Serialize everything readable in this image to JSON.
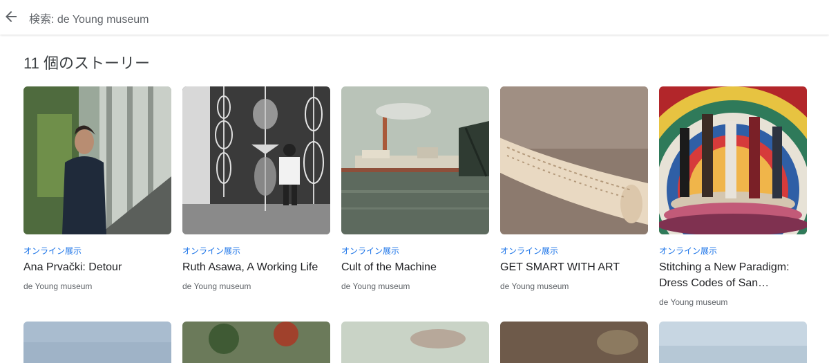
{
  "search": {
    "text": "検索: de Young museum"
  },
  "heading": "11 個のストーリー",
  "cards": [
    {
      "category": "オンライン展示",
      "title": "Ana Prvački: Detour",
      "source": "de Young museum"
    },
    {
      "category": "オンライン展示",
      "title": "Ruth Asawa, A Working Life",
      "source": "de Young museum"
    },
    {
      "category": "オンライン展示",
      "title": "Cult of the Machine",
      "source": "de Young museum"
    },
    {
      "category": "オンライン展示",
      "title": "GET SMART WITH ART",
      "source": "de Young museum"
    },
    {
      "category": "オンライン展示",
      "title": "Stitching a New Paradigm: Dress Codes of San…",
      "source": "de Young museum"
    }
  ],
  "colors": {
    "accent": "#1a73e8"
  }
}
